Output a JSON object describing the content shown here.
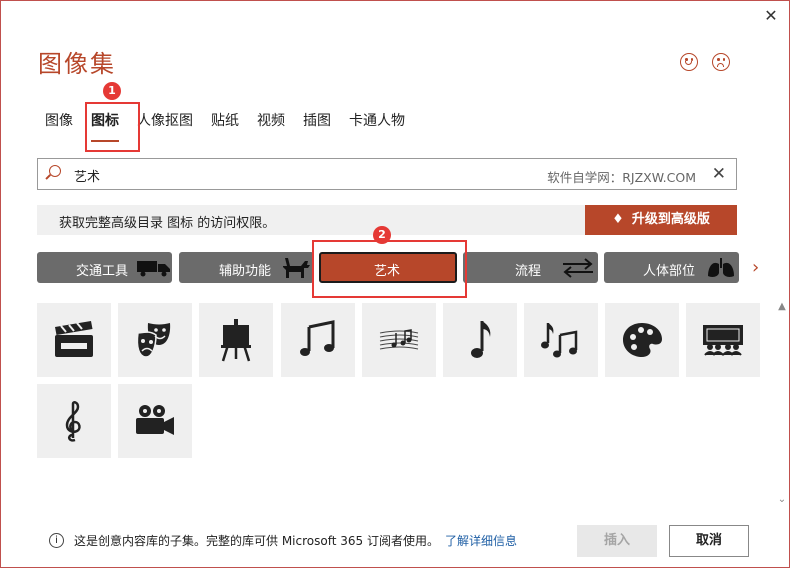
{
  "window": {
    "close_glyph": "✕"
  },
  "title": "图像集",
  "feedback": {
    "smile": "smile-icon",
    "frown": "frown-icon"
  },
  "tabs": [
    {
      "label": "图像",
      "active": false
    },
    {
      "label": "图标",
      "active": true
    },
    {
      "label": "人像抠图",
      "active": false
    },
    {
      "label": "贴纸",
      "active": false
    },
    {
      "label": "视频",
      "active": false
    },
    {
      "label": "插图",
      "active": false
    },
    {
      "label": "卡通人物",
      "active": false
    }
  ],
  "annotations": {
    "badge1": "1",
    "badge2": "2"
  },
  "search": {
    "value": "艺术",
    "watermark": "软件自学网：RJZXW.COM",
    "clear_glyph": "✕"
  },
  "promo": {
    "text": "获取完整高级目录 图标 的访问权限。",
    "button_label": "升级到高级版",
    "gem_glyph": "♦"
  },
  "categories": [
    {
      "label": "交通工具",
      "icon": "truck-icon",
      "glyph": "🚚"
    },
    {
      "label": "辅助功能",
      "icon": "service-dog-icon",
      "glyph": "🐕"
    },
    {
      "label": "艺术",
      "icon": "",
      "glyph": "",
      "active": true
    },
    {
      "label": "流程",
      "icon": "exchange-arrows-icon",
      "glyph": "⇆"
    },
    {
      "label": "人体部位",
      "icon": "lungs-icon",
      "glyph": "🫁"
    }
  ],
  "next_arrow": "›",
  "icons": [
    "clapperboard-icon",
    "theater-masks-icon",
    "easel-icon",
    "music-notes-icon",
    "sheet-music-icon",
    "eighth-note-icon",
    "notes-icon",
    "paint-palette-icon",
    "theater-audience-icon",
    "treble-clef-icon",
    "movie-camera-icon"
  ],
  "footer": {
    "info_glyph": "i",
    "info_text": "这是创意内容库的子集。完整的库可供 Microsoft 365 订阅者使用。",
    "link": "了解详细信息",
    "insert_label": "插入",
    "cancel_label": "取消"
  },
  "colors": {
    "accent": "#b7472a",
    "category_bg": "#6b6b6b",
    "tile_bg": "#efefef",
    "callout": "#e53935"
  }
}
